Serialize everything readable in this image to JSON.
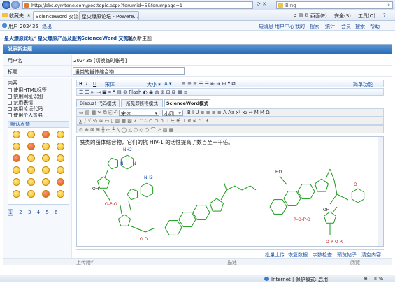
{
  "browser": {
    "url": "http://bbs.symtone.com/posttopic.aspx?forumid=5&forumpage=1",
    "search_placeholder": "Bing",
    "favorites_label": "收藏夹",
    "tab1": "ScienceWord 交流区",
    "tab2": "星火爆原论坛 - Powere...",
    "toolbar": [
      "页面(P)",
      "安全(S)",
      "工具(O)"
    ]
  },
  "site_bar": {
    "login": "用户 202435",
    "logout": "退出",
    "links": [
      "短消息",
      "用户中心",
      "我的",
      "搜索",
      "统计",
      "会员",
      "搜索",
      "帮助"
    ]
  },
  "breadcrumb": [
    "星火爆原论坛",
    "星火爆原产品及服务",
    "ScienceWord 交流区",
    "发表新主题"
  ],
  "form": {
    "panel_title": "发表新主题",
    "username_label": "用户名",
    "username_value": "202435 [切换临时帐号]",
    "title_label": "标题",
    "title_value": "甾类的甾体缩合物",
    "content_label": "内容",
    "options": [
      "使用HTML标签",
      "禁用网址识别",
      "禁用表情",
      "禁用论坛代码",
      "使用个人签名"
    ],
    "emoji_title": "默认表情",
    "emoji_pages": [
      "1",
      "2",
      "3",
      "4",
      "5",
      "6"
    ],
    "mode_tabs": [
      "Discuz! 代码模式",
      "所见即所得模式",
      "ScienceWord模式"
    ],
    "simple_mode": "简单功能",
    "editor_font": "宋体",
    "editor_size": "小四",
    "editor_text": "酰类的甾体缩合物，它们的抗 HIV-1 的活性提高了数百至一千倍。",
    "bottom_actions": [
      "批量上传",
      "恢复数据",
      "字数检查",
      "预览帖子",
      "清空内容"
    ],
    "attach_label": "上传附件",
    "desc_label": "描述",
    "price_label": "阅覽"
  },
  "chemistry": {
    "labels": [
      "NH2",
      "NH2",
      "N",
      "N",
      "N",
      "N",
      "HO",
      "OH",
      "O",
      "O",
      "OH",
      "R",
      "H",
      "P"
    ]
  },
  "status": {
    "internet": "Internet | 保护模式: 启用",
    "zoom": "100%"
  },
  "colors": {
    "molecule": "#1a9a1a",
    "link": "#1a4fa0",
    "head": "#2a6cb8"
  }
}
